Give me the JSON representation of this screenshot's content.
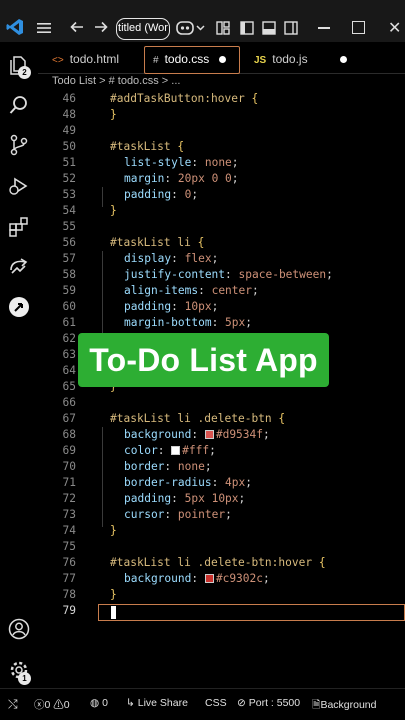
{
  "titlebar": {
    "command_center": "titled (Wor",
    "icons": [
      "vscode-logo",
      "menu-icon",
      "back-icon",
      "forward-icon",
      "copilot-icon",
      "layout-icons",
      "window-controls"
    ]
  },
  "tabs": [
    {
      "icon": "<>",
      "label": "todo.html",
      "active": false,
      "dirty": false
    },
    {
      "icon": "#",
      "label": "todo.css",
      "active": true,
      "dirty": true
    },
    {
      "icon": "JS",
      "label": "todo.js",
      "active": false,
      "dirty": true
    }
  ],
  "breadcrumb": {
    "folder": "Todo List",
    "sep": ">",
    "file": "# todo.css",
    "more": "> ..."
  },
  "activity": {
    "explorer_badge": "2",
    "accounts_badge": "",
    "settings_badge": "1"
  },
  "editor": {
    "lines": [
      {
        "n": "46",
        "segs": [
          [
            "sel",
            "#addTaskButton:hover "
          ],
          [
            "brace",
            "{"
          ]
        ],
        "indent": 0
      },
      {
        "n": "48",
        "segs": [
          [
            "brace",
            "}"
          ]
        ],
        "indent": 0
      },
      {
        "n": "49",
        "segs": [],
        "indent": 0
      },
      {
        "n": "50",
        "segs": [
          [
            "sel",
            "#taskList "
          ],
          [
            "brace",
            "{"
          ]
        ],
        "indent": 0
      },
      {
        "n": "51",
        "segs": [
          [
            "prop",
            "list-style"
          ],
          [
            "punct",
            ": "
          ],
          [
            "val",
            "none"
          ],
          [
            "punct",
            ";"
          ]
        ],
        "indent": 1
      },
      {
        "n": "52",
        "segs": [
          [
            "prop",
            "margin"
          ],
          [
            "punct",
            ": "
          ],
          [
            "val",
            "20px 0 0"
          ],
          [
            "punct",
            ";"
          ]
        ],
        "indent": 1
      },
      {
        "n": "53",
        "segs": [
          [
            "prop",
            "padding"
          ],
          [
            "punct",
            ": "
          ],
          [
            "val",
            "0"
          ],
          [
            "punct",
            ";"
          ]
        ],
        "indent": 1
      },
      {
        "n": "54",
        "segs": [
          [
            "brace",
            "}"
          ]
        ],
        "indent": 0
      },
      {
        "n": "55",
        "segs": [],
        "indent": 0
      },
      {
        "n": "56",
        "segs": [
          [
            "sel",
            "#taskList li "
          ],
          [
            "brace",
            "{"
          ]
        ],
        "indent": 0
      },
      {
        "n": "57",
        "segs": [
          [
            "prop",
            "display"
          ],
          [
            "punct",
            ": "
          ],
          [
            "val",
            "flex"
          ],
          [
            "punct",
            ";"
          ]
        ],
        "indent": 1
      },
      {
        "n": "58",
        "segs": [
          [
            "prop",
            "justify-content"
          ],
          [
            "punct",
            ": "
          ],
          [
            "val",
            "space-between"
          ],
          [
            "punct",
            ";"
          ]
        ],
        "indent": 1
      },
      {
        "n": "59",
        "segs": [
          [
            "prop",
            "align-items"
          ],
          [
            "punct",
            ": "
          ],
          [
            "val",
            "center"
          ],
          [
            "punct",
            ";"
          ]
        ],
        "indent": 1
      },
      {
        "n": "60",
        "segs": [
          [
            "prop",
            "padding"
          ],
          [
            "punct",
            ": "
          ],
          [
            "val",
            "10px"
          ],
          [
            "punct",
            ";"
          ]
        ],
        "indent": 1
      },
      {
        "n": "61",
        "segs": [
          [
            "prop",
            "margin-bottom"
          ],
          [
            "punct",
            ": "
          ],
          [
            "val",
            "5px"
          ],
          [
            "punct",
            ";"
          ]
        ],
        "indent": 1
      },
      {
        "n": "62",
        "segs": [],
        "indent": 0
      },
      {
        "n": "63",
        "segs": [],
        "indent": 0
      },
      {
        "n": "64",
        "segs": [],
        "indent": 0
      },
      {
        "n": "65",
        "segs": [
          [
            "brace",
            "}"
          ]
        ],
        "indent": 0
      },
      {
        "n": "66",
        "segs": [],
        "indent": 0
      },
      {
        "n": "67",
        "segs": [
          [
            "sel",
            "#taskList li .delete-btn "
          ],
          [
            "brace",
            "{"
          ]
        ],
        "indent": 0
      },
      {
        "n": "68",
        "segs": [
          [
            "prop",
            "background"
          ],
          [
            "punct",
            ": "
          ],
          [
            "swatch",
            "#d9534f"
          ],
          [
            "val",
            "#d9534f"
          ],
          [
            "punct",
            ";"
          ]
        ],
        "indent": 1
      },
      {
        "n": "69",
        "segs": [
          [
            "prop",
            "color"
          ],
          [
            "punct",
            ": "
          ],
          [
            "swatch",
            "#ffffff"
          ],
          [
            "val",
            "#fff"
          ],
          [
            "punct",
            ";"
          ]
        ],
        "indent": 1
      },
      {
        "n": "70",
        "segs": [
          [
            "prop",
            "border"
          ],
          [
            "punct",
            ": "
          ],
          [
            "val",
            "none"
          ],
          [
            "punct",
            ";"
          ]
        ],
        "indent": 1
      },
      {
        "n": "71",
        "segs": [
          [
            "prop",
            "border-radius"
          ],
          [
            "punct",
            ": "
          ],
          [
            "val",
            "4px"
          ],
          [
            "punct",
            ";"
          ]
        ],
        "indent": 1
      },
      {
        "n": "72",
        "segs": [
          [
            "prop",
            "padding"
          ],
          [
            "punct",
            ": "
          ],
          [
            "val",
            "5px 10px"
          ],
          [
            "punct",
            ";"
          ]
        ],
        "indent": 1
      },
      {
        "n": "73",
        "segs": [
          [
            "prop",
            "cursor"
          ],
          [
            "punct",
            ": "
          ],
          [
            "val",
            "pointer"
          ],
          [
            "punct",
            ";"
          ]
        ],
        "indent": 1
      },
      {
        "n": "74",
        "segs": [
          [
            "brace",
            "}"
          ]
        ],
        "indent": 0
      },
      {
        "n": "75",
        "segs": [],
        "indent": 0
      },
      {
        "n": "76",
        "segs": [
          [
            "sel",
            "#taskList li .delete-btn:hover "
          ],
          [
            "brace",
            "{"
          ]
        ],
        "indent": 0
      },
      {
        "n": "77",
        "segs": [
          [
            "prop",
            "background"
          ],
          [
            "punct",
            ": "
          ],
          [
            "swatch",
            "#c9302c"
          ],
          [
            "val",
            "#c9302c"
          ],
          [
            "punct",
            ";"
          ]
        ],
        "indent": 1
      },
      {
        "n": "78",
        "segs": [
          [
            "brace",
            "}"
          ]
        ],
        "indent": 0
      },
      {
        "n": "79",
        "segs": [],
        "indent": 0,
        "current": true
      }
    ]
  },
  "overlay": {
    "text": "To-Do List App",
    "color": "#2dae33"
  },
  "statusbar": {
    "errors": "0",
    "warnings": "0",
    "ports": "0",
    "live_share": "Live Share",
    "language": "CSS",
    "port": "Port : 5500",
    "background": "Background"
  },
  "colors": {
    "accent_border": "#c87d4d",
    "selector": "#d7ba7d",
    "property": "#9cdcfe",
    "value": "#ce9178"
  }
}
